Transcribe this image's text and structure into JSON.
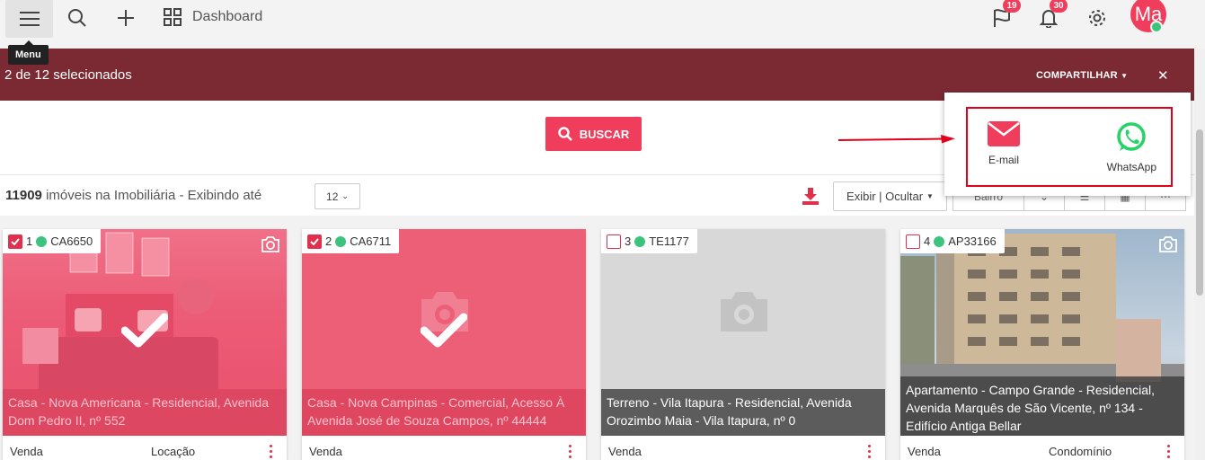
{
  "topbar": {
    "dashboard_label": "Dashboard",
    "flag_badge": "19",
    "bell_badge": "30",
    "avatar_initials": "Ma",
    "tooltip": "Menu"
  },
  "selection": {
    "count_text": "2 de 12 selecionados",
    "share_label": "COMPARTILHAR",
    "close_symbol": "✕"
  },
  "search": {
    "buscar_label": "BUSCAR"
  },
  "results": {
    "total": "11909",
    "info_text": "imóveis na Imobiliária - Exibindo até",
    "per_page": "12",
    "exibir_label": "Exibir | Ocultar",
    "sort_label": "Bairro"
  },
  "share_menu": {
    "email_label": "E-mail",
    "whatsapp_label": "WhatsApp"
  },
  "colors": {
    "accent": "#ef3d5b",
    "bar": "#7b2932",
    "whatsapp": "#25d366"
  },
  "cards": [
    {
      "index": "1",
      "code": "CA6650",
      "checked": true,
      "caption": "Casa - Nova Americana - Residencial, Avenida Dom Pedro II, nº 552",
      "foot_left": "Venda",
      "foot_right": "Locação"
    },
    {
      "index": "2",
      "code": "CA6711",
      "checked": true,
      "caption": "Casa - Nova Campinas - Comercial, Acesso À Avenida José de Souza Campos, nº 44444",
      "foot_left": "Venda",
      "foot_right": ""
    },
    {
      "index": "3",
      "code": "TE1177",
      "checked": false,
      "caption": "Terreno - Vila Itapura - Residencial, Avenida Orozimbo Maia - Vila Itapura, nº 0",
      "foot_left": "Venda",
      "foot_right": ""
    },
    {
      "index": "4",
      "code": "AP33166",
      "checked": false,
      "caption": "Apartamento - Campo Grande - Residencial, Avenida Marquês de São Vicente, nº 134 - Edifício Antiga Bellar",
      "foot_left": "Venda",
      "foot_right": "Condomínio"
    }
  ]
}
